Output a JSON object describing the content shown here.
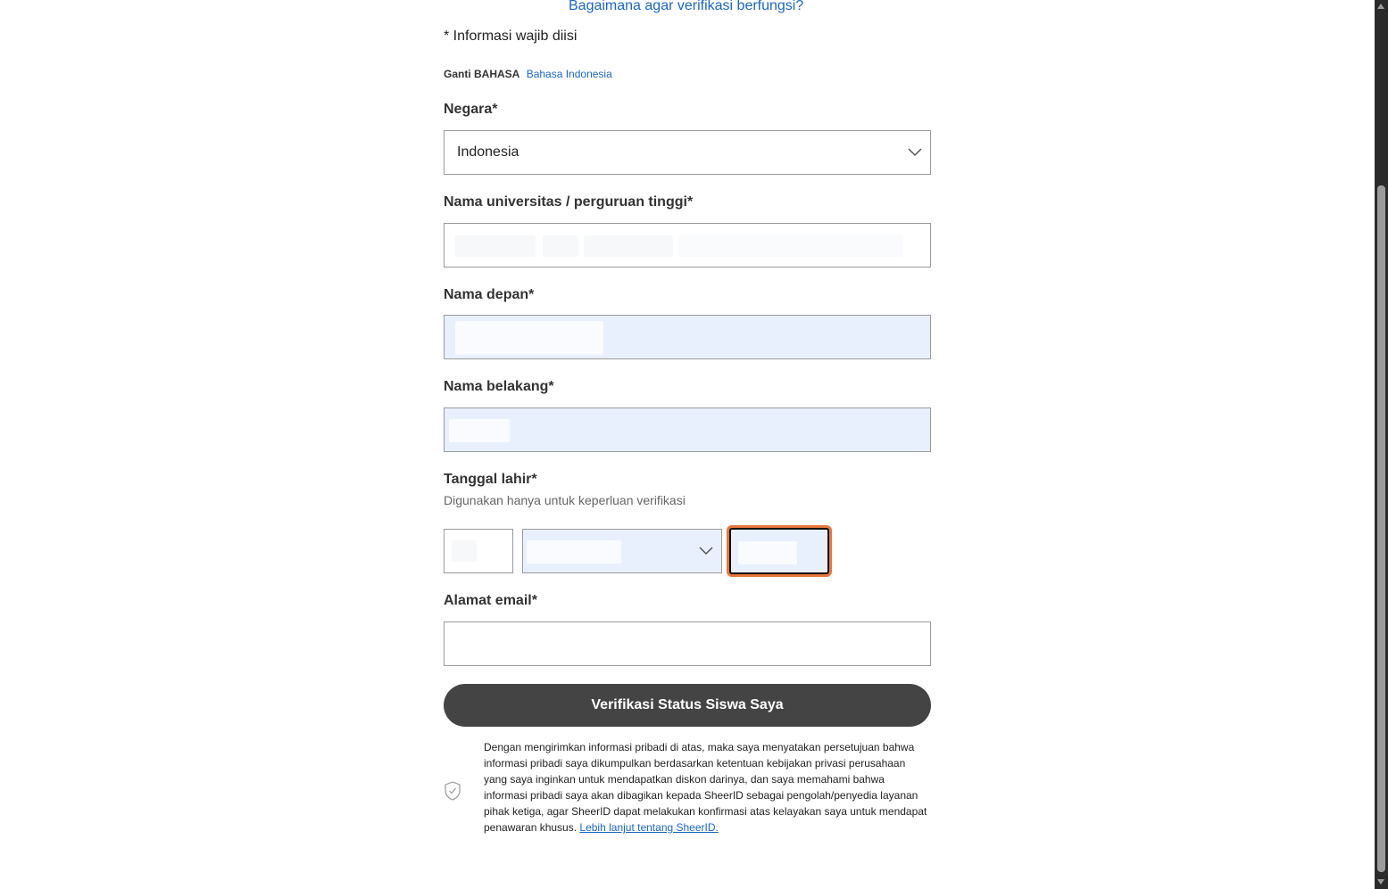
{
  "header": {
    "help_link": "Bagaimana agar verifikasi berfungsi?",
    "required_note": "* Informasi wajib diisi",
    "language_label": "Ganti BAHASA",
    "language_value": "Bahasa Indonesia"
  },
  "form": {
    "country": {
      "label": "Negara*",
      "value": "Indonesia"
    },
    "university": {
      "label": "Nama universitas / perguruan tinggi*",
      "value": ""
    },
    "first_name": {
      "label": "Nama depan*",
      "value": ""
    },
    "last_name": {
      "label": "Nama belakang*",
      "value": ""
    },
    "birth_date": {
      "label": "Tanggal lahir*",
      "help": "Digunakan hanya untuk keperluan verifikasi",
      "day": "",
      "month": "",
      "year": ""
    },
    "email": {
      "label": "Alamat email*",
      "value": ""
    },
    "submit_label": "Verifikasi Status Siswa Saya"
  },
  "consent": {
    "text": "Dengan mengirimkan informasi pribadi di atas, maka saya menyatakan persetujuan bahwa informasi pribadi saya dikumpulkan berdasarkan ketentuan kebijakan privasi perusahaan yang saya inginkan untuk mendapatkan diskon darinya, dan saya memahami bahwa informasi pribadi saya akan dibagikan kepada SheerID sebagai pengolah/penyedia layanan pihak ketiga, agar SheerID dapat melakukan konfirmasi atas kelayakan saya untuk mendapat penawaran khusus. ",
    "link": "Lebih lanjut tentang SheerID."
  },
  "icons": {
    "select_arrow": "chevron-down-icon",
    "privacy": "shield-check-icon"
  },
  "colors": {
    "link": "#1a66c9",
    "button": "#444444",
    "autofill": "#e8f0fe",
    "focus": "#e8773d"
  }
}
